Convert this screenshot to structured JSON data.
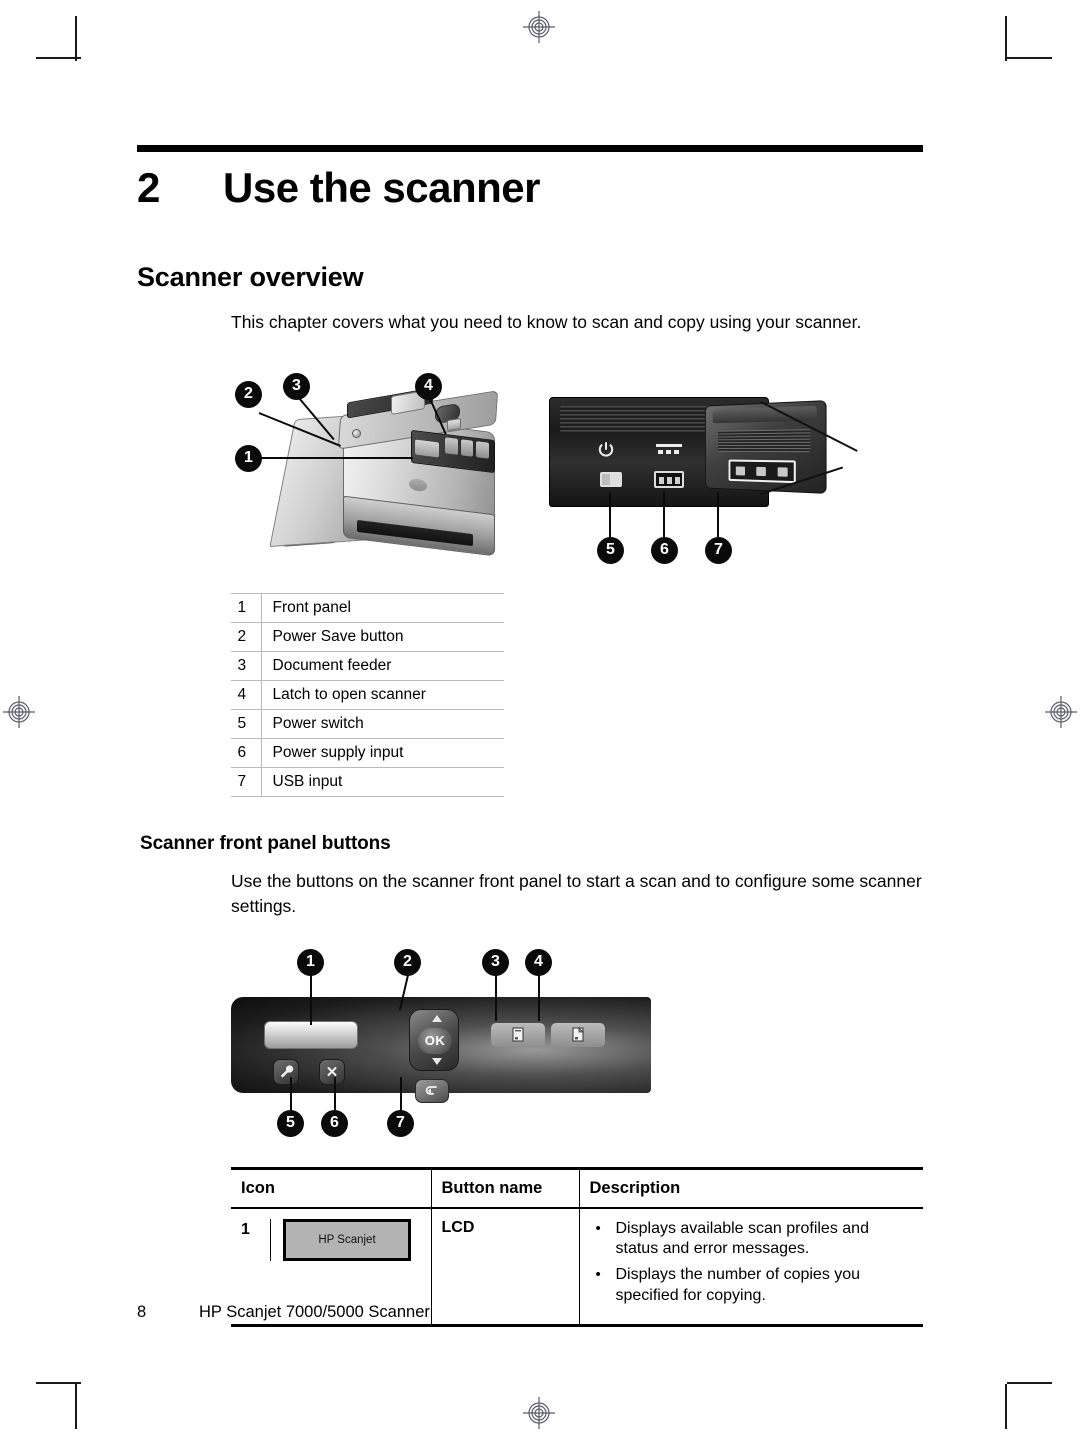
{
  "chapter": {
    "number": "2",
    "title": "Use the scanner"
  },
  "section": {
    "title": "Scanner overview",
    "intro": "This chapter covers what you need to know to scan and copy using your scanner."
  },
  "figure_overview": {
    "callouts": [
      "1",
      "2",
      "3",
      "4",
      "5",
      "6",
      "7"
    ],
    "port_icons": {
      "power": "power-symbol",
      "dc": "dc-power-icon",
      "usb": "usb-icon"
    }
  },
  "parts_list": [
    {
      "num": "1",
      "label": "Front panel"
    },
    {
      "num": "2",
      "label": "Power Save button"
    },
    {
      "num": "3",
      "label": "Document feeder"
    },
    {
      "num": "4",
      "label": "Latch to open scanner"
    },
    {
      "num": "5",
      "label": "Power switch"
    },
    {
      "num": "6",
      "label": "Power supply input"
    },
    {
      "num": "7",
      "label": "USB input"
    }
  ],
  "subsection": {
    "title": "Scanner front panel buttons",
    "intro": "Use the buttons on the scanner front panel to start a scan and to configure some scanner settings."
  },
  "figure_front_panel": {
    "callouts": [
      "1",
      "2",
      "3",
      "4",
      "5",
      "6",
      "7"
    ],
    "ok_label": "OK",
    "cancel_glyph": "✕",
    "back_glyph": "↩",
    "tools_glyph": "wrench-icon"
  },
  "button_table": {
    "headers": [
      "Icon",
      "Button name",
      "Description"
    ],
    "rows": [
      {
        "num": "1",
        "icon_text": "HP Scanjet",
        "name": "LCD",
        "description": [
          "Displays available scan profiles and status and error messages.",
          "Displays the number of copies you specified for copying."
        ]
      }
    ]
  },
  "footer": {
    "page_number": "8",
    "product": "HP Scanjet 7000/5000 Scanner"
  }
}
